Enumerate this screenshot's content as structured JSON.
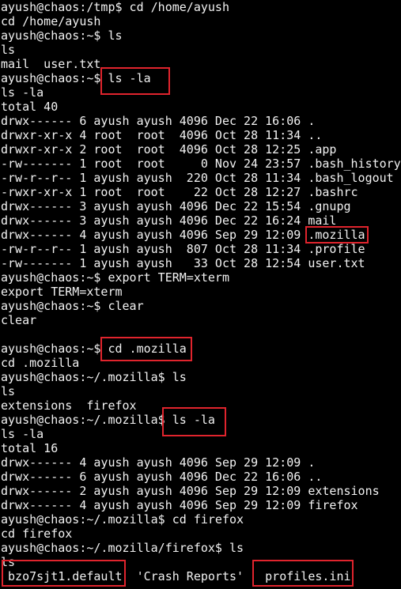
{
  "terminal": {
    "lines": [
      "ayush@chaos:/tmp$ cd /home/ayush",
      "cd /home/ayush",
      "ayush@chaos:~$ ls",
      "ls",
      "mail  user.txt",
      "ayush@chaos:~$ ls -la",
      "ls -la",
      "total 40",
      "drwx------ 6 ayush ayush 4096 Dec 22 16:06 .",
      "drwxr-xr-x 4 root  root  4096 Oct 28 11:34 ..",
      "drwxr-xr-x 2 root  root  4096 Oct 28 12:25 .app",
      "-rw------- 1 root  root     0 Nov 24 23:57 .bash_history",
      "-rw-r--r-- 1 ayush ayush  220 Oct 28 11:34 .bash_logout",
      "-rwxr-xr-x 1 root  root    22 Oct 28 12:27 .bashrc",
      "drwx------ 3 ayush ayush 4096 Dec 22 15:54 .gnupg",
      "drwx------ 3 ayush ayush 4096 Dec 22 16:24 mail",
      "drwx------ 4 ayush ayush 4096 Sep 29 12:09 .mozilla",
      "-rw-r--r-- 1 ayush ayush  807 Oct 28 11:34 .profile",
      "-rw------- 1 ayush ayush   33 Oct 28 12:54 user.txt",
      "ayush@chaos:~$ export TERM=xterm",
      "export TERM=xterm",
      "ayush@chaos:~$ clear",
      "clear",
      "",
      "ayush@chaos:~$ cd .mozilla",
      "cd .mozilla",
      "ayush@chaos:~/.mozilla$ ls",
      "ls",
      "extensions  firefox",
      "ayush@chaos:~/.mozilla$ ls -la",
      "ls -la",
      "total 16",
      "drwx------ 4 ayush ayush 4096 Sep 29 12:09 .",
      "drwx------ 6 ayush ayush 4096 Dec 22 16:06 ..",
      "drwx------ 2 ayush ayush 4096 Sep 29 12:09 extensions",
      "drwx------ 4 ayush ayush 4096 Sep 29 12:09 firefox",
      "ayush@chaos:~/.mozilla$ cd firefox",
      "cd firefox",
      "ayush@chaos:~/.mozilla/firefox$ ls",
      "ls",
      " bzo7sjt1.default  'Crash Reports'   profiles.ini"
    ]
  },
  "colors": {
    "background": "#000000",
    "foreground": "#f2f2f2",
    "highlight": "#e0242d"
  }
}
